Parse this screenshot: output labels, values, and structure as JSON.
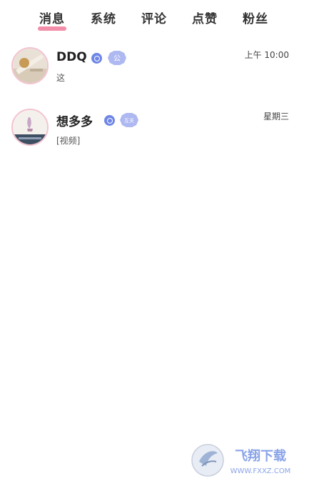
{
  "tabs": [
    {
      "label": "消息",
      "active": true
    },
    {
      "label": "系统",
      "active": false
    },
    {
      "label": "评论",
      "active": false
    },
    {
      "label": "点赞",
      "active": false
    },
    {
      "label": "粉丝",
      "active": false
    }
  ],
  "messages": [
    {
      "name": "DDQ",
      "preview": "这",
      "time": "上午 10:00",
      "badge_text": "公"
    },
    {
      "name": "想多多",
      "preview": "[视频]",
      "time": "星期三",
      "badge_text": "互关"
    }
  ],
  "watermark": {
    "brand": "飞翔下载",
    "url": "WWW.FXXZ.COM"
  },
  "colors": {
    "accent": "#f07a9a",
    "verify": "#6f86e6",
    "badge": "#9aa6ee"
  }
}
